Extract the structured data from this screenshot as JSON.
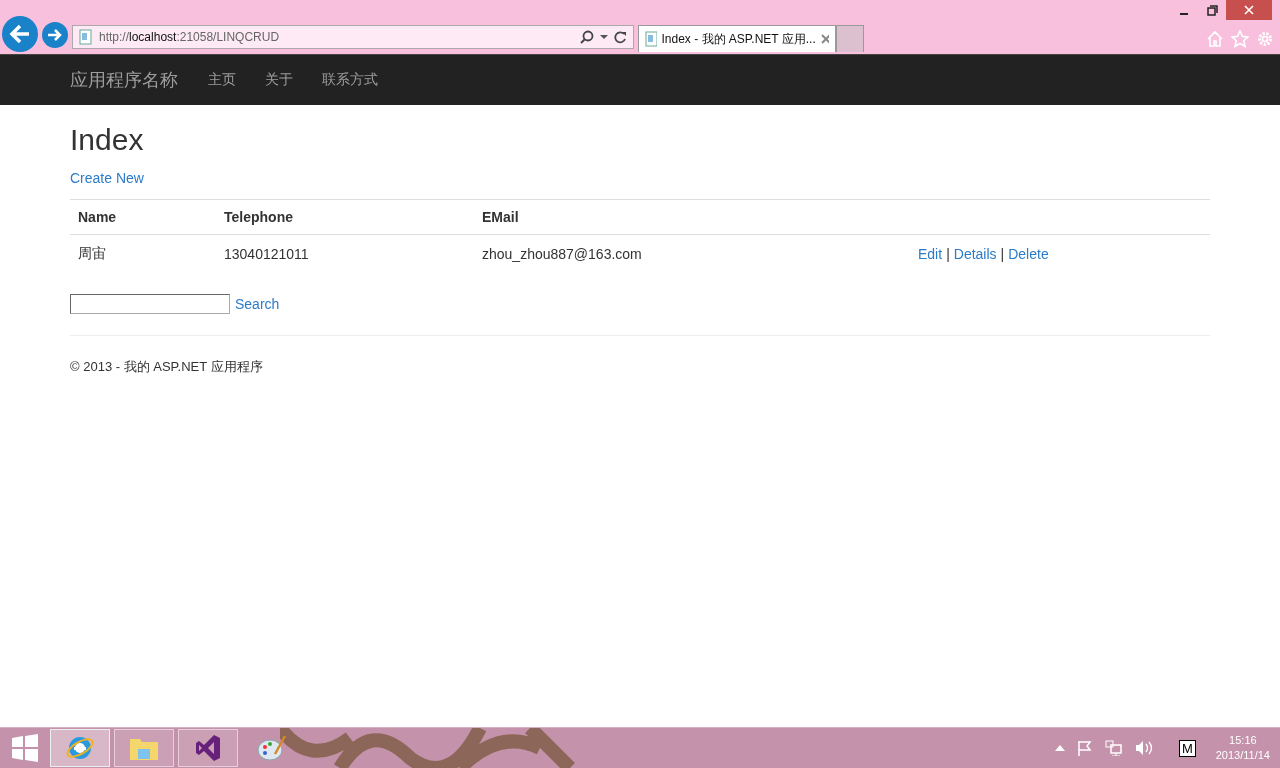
{
  "browser": {
    "url": "http://**localhost**:21058/LINQCRUD",
    "tabs": [
      {
        "title": "Index - 我的 ASP.NET 应用...",
        "selected": true
      }
    ]
  },
  "navbar": {
    "brand": "应用程序名称",
    "links": [
      "主页",
      "关于",
      "联系方式"
    ]
  },
  "page": {
    "title": "Index",
    "create_link": "Create New",
    "table": {
      "columns": [
        "Name",
        "Telephone",
        "EMail"
      ],
      "rows": [
        {
          "name": "周宙",
          "telephone": "13040121011",
          "email": "zhou_zhou887@163.com",
          "actions": [
            "Edit",
            "Details",
            "Delete"
          ],
          "separator": "|"
        }
      ]
    },
    "search": {
      "button": "Search"
    },
    "footer": "© 2013 - 我的 ASP.NET 应用程序"
  },
  "taskbar": {
    "apps": [
      {
        "kind": "ie",
        "selected": true
      },
      {
        "kind": "explorer",
        "selected": false
      },
      {
        "kind": "vs",
        "selected": false
      },
      {
        "kind": "paint",
        "selected": false
      }
    ],
    "ime": "M",
    "time": "15:16",
    "date": "2013/11/14"
  }
}
